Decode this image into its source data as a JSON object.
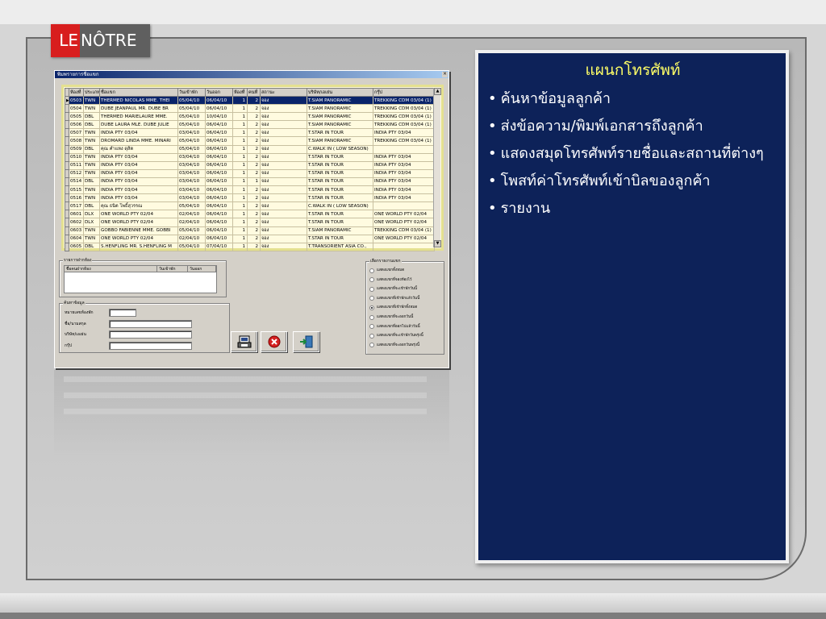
{
  "logo": {
    "left": "LE",
    "right": "NÔTRE"
  },
  "app": {
    "title": "พิมพรายการชื่อแขก",
    "columns": [
      "ห้องที่",
      "ประเภท",
      "ชื่อแขก",
      "วันเข้าพัก",
      "วันออก",
      "ห้องที่",
      "คนที่",
      "สถานะ",
      "บริษัท/เอเย่น",
      "กรุ๊ป"
    ],
    "rows": [
      [
        "0503",
        "TWN",
        "THERMED NICOLAS MME. THEI",
        "05/04/10",
        "06/04/10",
        "1",
        "2",
        "จอง",
        "T.SIAM PANORAMIC",
        "TREKKING CDM 03/04 (1)"
      ],
      [
        "0504",
        "TWN",
        "DUBE JEANPAUL MR. DUBE BR",
        "05/04/10",
        "06/04/10",
        "1",
        "2",
        "จอง",
        "T.SIAM PANORAMIC",
        "TREKKING CDM 03/04 (1)"
      ],
      [
        "0505",
        "DBL",
        "THERMED MARIELAURE MME.",
        "05/04/10",
        "10/04/10",
        "1",
        "2",
        "จอง",
        "T.SIAM PANORAMIC",
        "TREKKING CDM 03/04 (1)"
      ],
      [
        "0506",
        "DBL",
        "DUBE LAURA MLE. DUBE JULIE",
        "05/04/10",
        "06/04/10",
        "1",
        "2",
        "จอง",
        "T.SIAM PANORAMIC",
        "TREKKING CDM 03/04 (1)"
      ],
      [
        "0507",
        "TWN",
        "INDIA PTY 03/04",
        "03/04/10",
        "06/04/10",
        "1",
        "2",
        "จอง",
        "T.STAR IN TOUR",
        "INDIA PTY 03/04"
      ],
      [
        "0508",
        "TWN",
        "DROMARD LINDA MME. MINARI",
        "05/04/10",
        "06/04/10",
        "1",
        "2",
        "จอง",
        "T.SIAM PANORAMIC",
        "TREKKING CDM 03/04 (1)"
      ],
      [
        "0509",
        "DBL",
        "คุณ คำแหง ดุสิต",
        "05/04/10",
        "06/04/10",
        "1",
        "2",
        "จอง",
        "C.WALK IN ( LOW SEASON)",
        ""
      ],
      [
        "0510",
        "TWN",
        "INDIA PTY 03/04",
        "03/04/10",
        "06/04/10",
        "1",
        "2",
        "จอง",
        "T.STAR IN TOUR",
        "INDIA PTY 03/04"
      ],
      [
        "0511",
        "TWN",
        "INDIA PTY 03/04",
        "03/04/10",
        "06/04/10",
        "1",
        "2",
        "จอง",
        "T.STAR IN TOUR",
        "INDIA PTY 03/04"
      ],
      [
        "0512",
        "TWN",
        "INDIA PTY 03/04",
        "03/04/10",
        "06/04/10",
        "1",
        "2",
        "จอง",
        "T.STAR IN TOUR",
        "INDIA PTY 03/04"
      ],
      [
        "0514",
        "DBL",
        "INDIA PTY 03/04",
        "03/04/10",
        "06/04/10",
        "1",
        "1",
        "จอง",
        "T.STAR IN TOUR",
        "INDIA PTY 03/04"
      ],
      [
        "0515",
        "TWN",
        "INDIA PTY 03/04",
        "03/04/10",
        "06/04/10",
        "1",
        "2",
        "จอง",
        "T.STAR IN TOUR",
        "INDIA PTY 03/04"
      ],
      [
        "0516",
        "TWN",
        "INDIA PTY 03/04",
        "03/04/10",
        "06/04/10",
        "1",
        "2",
        "จอง",
        "T.STAR IN TOUR",
        "INDIA PTY 03/04"
      ],
      [
        "0517",
        "DBL",
        "คุณ ธนิต โพธิ์สุวรรณ",
        "05/04/10",
        "06/04/10",
        "1",
        "2",
        "จอง",
        "C.WALK IN ( LOW SEASON)",
        ""
      ],
      [
        "0601",
        "DLX",
        "ONE WORLD PTY 02/04",
        "02/04/10",
        "06/04/10",
        "1",
        "2",
        "จอง",
        "T.STAR IN TOUR",
        "ONE WORLD PTY 02/04"
      ],
      [
        "0602",
        "DLX",
        "ONE WORLD PTY 02/04",
        "02/04/10",
        "06/04/10",
        "1",
        "2",
        "จอง",
        "T.STAR IN TOUR",
        "ONE WORLD PTY 02/04"
      ],
      [
        "0603",
        "TWN",
        "GOBBO FABIENNE MME. GOBBI",
        "05/04/10",
        "06/04/10",
        "1",
        "2",
        "จอง",
        "T.SIAM PANORAMIC",
        "TREKKING CDM 03/04 (1)"
      ],
      [
        "0604",
        "TWN",
        "ONE WORLD PTY 02/04",
        "02/04/10",
        "06/04/10",
        "1",
        "2",
        "จอง",
        "T.STAR IN TOUR",
        "ONE WORLD PTY 02/04"
      ],
      [
        "0605",
        "DBL",
        "S.HENFLING MR. S.HENFLING M",
        "05/04/10",
        "07/04/10",
        "1",
        "2",
        "จอง",
        "T.TRANSORIENT ASIA CO.,",
        ""
      ]
    ],
    "deposit": {
      "title": "รายการฝากห้อง",
      "columns": [
        "ชื่อคนฝากห้อง",
        "วันเข้าพัก",
        "วันออก"
      ]
    },
    "search": {
      "title": "ค้นหาข้อมูล",
      "fields": [
        "หมายเลขห้องพัก",
        "ชื่อ/นามสกุล",
        "บริษัท/เอเย่น",
        "กรุ๊ป"
      ]
    },
    "options": {
      "title": "เลือกรายงานแขก",
      "items": [
        "แสดงแขกทั้งหมด",
        "แสดงแขกที่จองห้องไว้",
        "แสดงแขกที่จะเข้าพักวันนี้",
        "แสดงแขกที่เข้าพักแล้ววันนี้",
        "แสดงแขกที่เข้าพักทั้งหมด",
        "แสดงแขกที่จะออกวันนี้",
        "แสดงแขกที่ออกไปแล้ววันนี้",
        "แสดงแขกที่จะเข้าพักวันพรุ่งนี้",
        "แสดงแขกที่จะออกวันพรุ่งนี้"
      ],
      "selected_index": 4
    }
  },
  "notes": {
    "title": "แผนกโทรศัพท์",
    "items": [
      "ค้นหาข้อมูลลูกค้า",
      "ส่งข้อความ/พิมพ์เอกสารถึงลูกค้า",
      "แสดงสมุดโทรศัพท์รายชื่อและสถานที่ต่างๆ",
      "โพสท์ค่าโทรศัพท์เข้าบิลของลูกค้า",
      "รายงาน"
    ]
  },
  "colors": {
    "panel": "#0d2259",
    "title": "#ffff66",
    "grid_selected": "#0a246a",
    "logo_red": "#d81e1e"
  }
}
